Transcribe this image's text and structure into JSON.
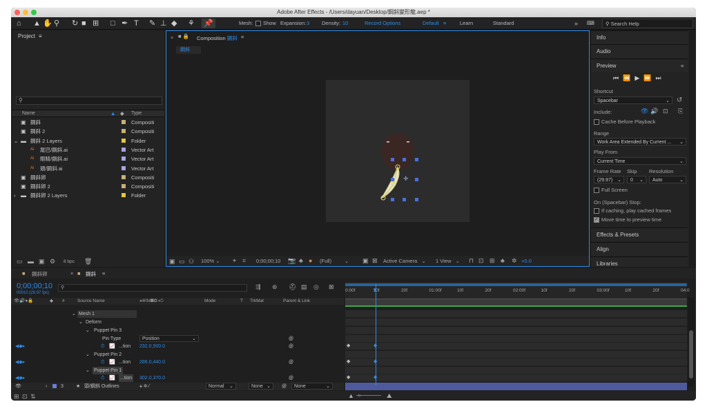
{
  "app": {
    "title": "Adobe After Effects - /Users/dayuan/Desktop/鋼斜變形龍.aep *"
  },
  "toolbar": {
    "mesh_label": "Mesh:",
    "show_label": "Show",
    "expansion_label": "Expansion:",
    "expansion_value": "3",
    "density_label": "Density:",
    "density_value": "10",
    "record_options": "Record Options",
    "workspace_default": "Default",
    "workspace_learn": "Learn",
    "workspace_standard": "Standard",
    "search_help": "Search Help"
  },
  "project": {
    "title": "Project",
    "search_placeholder": "",
    "columns": {
      "name": "Name",
      "type": "Type"
    },
    "items": [
      {
        "name": "鋼斜",
        "type": "Compositi",
        "color": "#c8b07a",
        "icon": "composition-icon",
        "indent": 0
      },
      {
        "name": "鋼斜 2",
        "type": "Compositi",
        "color": "#c8b07a",
        "icon": "composition-icon",
        "indent": 0
      },
      {
        "name": "鋼斜 2 Layers",
        "type": "Folder",
        "color": "#e3c83c",
        "icon": "folder-icon",
        "indent": 0
      },
      {
        "name": "尾巴/鋼斜.ai",
        "type": "Vector Art",
        "color": "#a8a4e0",
        "icon": "ai-file-icon",
        "indent": 1
      },
      {
        "name": "眼睛/鋼斜.ai",
        "type": "Vector Art",
        "color": "#a8a4e0",
        "icon": "ai-file-icon",
        "indent": 1
      },
      {
        "name": "頭/鋼斜.ai",
        "type": "Vector Art",
        "color": "#a8a4e0",
        "icon": "ai-file-icon",
        "indent": 1
      },
      {
        "name": "鋼斜卵",
        "type": "Compositi",
        "color": "#c8b07a",
        "icon": "composition-icon",
        "indent": 0
      },
      {
        "name": "鋼斜卵 2",
        "type": "Compositi",
        "color": "#c8b07a",
        "icon": "composition-icon",
        "indent": 0
      },
      {
        "name": "鋼斜卵 2 Layers",
        "type": "Folder",
        "color": "#e3c83c",
        "icon": "folder-icon",
        "indent": 0
      }
    ],
    "bpc": "8 bpc"
  },
  "composition": {
    "tab_title": "Composition",
    "comp_name": "鋼斜",
    "breadcrumb": "鋼斜",
    "zoom": "100%",
    "timecode": "0;00;00;10",
    "resolution": "(Full)",
    "camera": "Active Camera",
    "view": "1 View",
    "exposure": "+0.0"
  },
  "right_panel": {
    "info": "Info",
    "audio": "Audio",
    "preview": "Preview",
    "shortcut_label": "Shortcut",
    "shortcut_value": "Spacebar",
    "include_label": "Include:",
    "cache_before": "Cache Before Playback",
    "range_label": "Range",
    "range_value": "Work Area Extended By Current ...",
    "play_from_label": "Play From",
    "play_from_value": "Current Time",
    "frame_rate_label": "Frame Rate",
    "skip_label": "Skip",
    "resolution_label": "Resolution",
    "frame_rate_value": "(29.97)",
    "skip_value": "0",
    "resolution_value": "Auto",
    "full_screen": "Full Screen",
    "on_stop_label": "On (Spacebar) Stop:",
    "if_caching": "If caching, play cached frames",
    "move_time": "Move time to preview time",
    "effects": "Effects & Presets",
    "align": "Align",
    "libraries": "Libraries"
  },
  "timeline": {
    "tabs": [
      {
        "label": "鋼斜卵"
      },
      {
        "label": "鋼斜"
      }
    ],
    "current_time": "0;00;00;10",
    "fps": "00010 (29.97 fps)",
    "columns": {
      "source_name": "Source Name",
      "mode": "Mode",
      "t": "T",
      "trkmat": "TrkMat",
      "parent": "Parent & Link"
    },
    "rows": {
      "mesh": "Mesh 1",
      "deform": "Deform",
      "pin3": "Puppet Pin 3",
      "pin_type_label": "Pin Type",
      "pin_type_value": "Position",
      "pin3_pos_label": "...tion",
      "pin3_pos": "232.0,500.0",
      "pin2": "Puppet Pin 2",
      "pin2_pos_label": "...tion",
      "pin2_pos": "286.0,440.0",
      "pin1": "Puppet Pin 1",
      "pin1_pos_label": "...tion",
      "pin1_pos": "302.0,370.0",
      "layer_num": "3",
      "layer_name": "頭/鋼斜 Outlines",
      "layer_mode": "Normal",
      "layer_trkmat": "None",
      "layer_parent": "None"
    },
    "ruler": [
      "0:00f",
      "10f",
      "20f",
      "01:00f",
      "10f",
      "20f",
      "02:00f",
      "10f",
      "20f",
      "03:00f",
      "10f",
      "20f",
      "04:0"
    ]
  }
}
